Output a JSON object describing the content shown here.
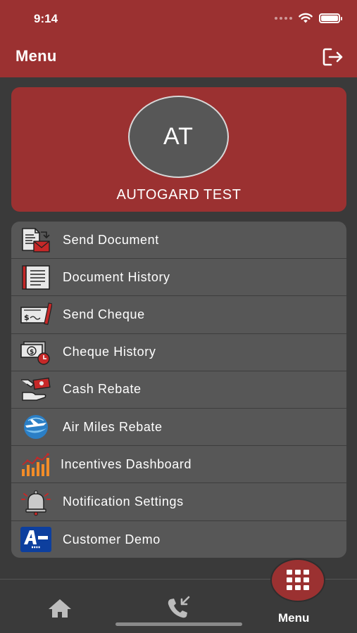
{
  "status_bar": {
    "time": "9:14"
  },
  "header": {
    "title": "Menu"
  },
  "profile": {
    "initials": "AT",
    "name": "AUTOGARD TEST"
  },
  "menu": {
    "items": [
      {
        "label": "Send Document",
        "icon": "send-document-icon"
      },
      {
        "label": "Document History",
        "icon": "document-history-icon"
      },
      {
        "label": "Send Cheque",
        "icon": "send-cheque-icon"
      },
      {
        "label": "Cheque History",
        "icon": "cheque-history-icon"
      },
      {
        "label": "Cash Rebate",
        "icon": "cash-rebate-icon"
      },
      {
        "label": "Air Miles Rebate",
        "icon": "air-miles-icon"
      },
      {
        "label": "Incentives Dashboard",
        "icon": "bar-chart-icon"
      },
      {
        "label": "Notification Settings",
        "icon": "bell-icon"
      },
      {
        "label": "Customer Demo",
        "icon": "ac-demo-logo-icon"
      }
    ]
  },
  "tabbar": {
    "menu_label": "Menu"
  },
  "colors": {
    "brand": "#9b3131",
    "background": "#3a3a3a",
    "panel": "#575757",
    "avatar": "#575757"
  }
}
